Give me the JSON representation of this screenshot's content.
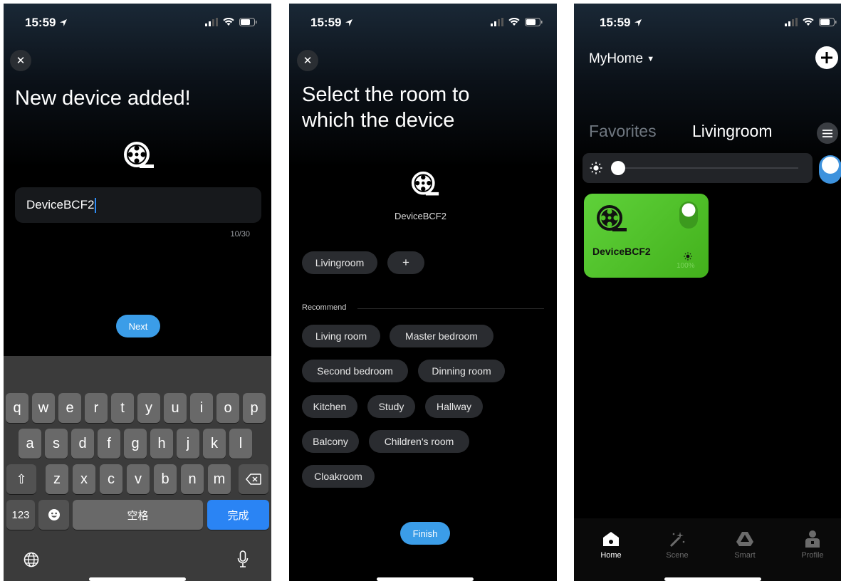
{
  "screen1": {
    "status": {
      "time": "15:59"
    },
    "title": "New device added!",
    "device_name_value": "DeviceBCF2",
    "char_counter": "10/30",
    "next_label": "Next",
    "keyboard": {
      "row1": [
        "q",
        "w",
        "e",
        "r",
        "t",
        "y",
        "u",
        "i",
        "o",
        "p"
      ],
      "row2": [
        "a",
        "s",
        "d",
        "f",
        "g",
        "h",
        "j",
        "k",
        "l"
      ],
      "row3": [
        "z",
        "x",
        "c",
        "v",
        "b",
        "n",
        "m"
      ],
      "numbers_label": "123",
      "space_label": "空格",
      "done_label": "完成"
    }
  },
  "screen2": {
    "status": {
      "time": "15:59"
    },
    "title_line1": "Select the room to",
    "title_line2": "which the device",
    "device_name": "DeviceBCF2",
    "selected_room": "Livingroom",
    "add_room_label": "+",
    "recommend_label": "Recommend",
    "rooms": [
      "Living room",
      "Master bedroom",
      "Second bedroom",
      "Dinning room",
      "Kitchen",
      "Study",
      "Hallway",
      "Balcony",
      "Children's room",
      "Cloakroom"
    ],
    "finish_label": "Finish"
  },
  "screen3": {
    "status": {
      "time": "15:59"
    },
    "home_name": "MyHome",
    "tabs": {
      "favorites": "Favorites",
      "current": "Livingroom"
    },
    "brightness_level": 0.0,
    "card": {
      "name": "DeviceBCF2",
      "brightness": "100%",
      "on": true,
      "color": "#52c22a"
    },
    "nav": [
      {
        "label": "Home",
        "icon": "home-icon",
        "active": true
      },
      {
        "label": "Scene",
        "icon": "magic-wand-icon",
        "active": false
      },
      {
        "label": "Smart",
        "icon": "smart-automation-icon",
        "active": false
      },
      {
        "label": "Profile",
        "icon": "profile-icon",
        "active": false
      }
    ]
  },
  "colors": {
    "accent": "#3b9de8",
    "keyboard_bg": "#3b3b3b",
    "card_green": "#52c22a"
  }
}
